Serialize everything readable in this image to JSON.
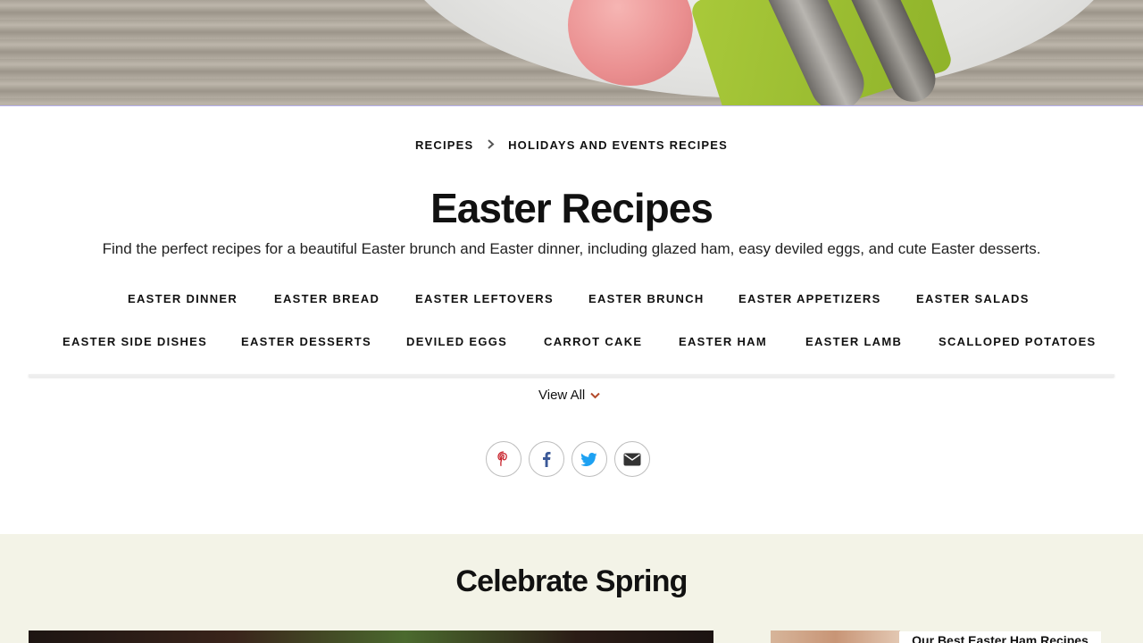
{
  "breadcrumb": [
    "RECIPES",
    "HOLIDAYS AND EVENTS RECIPES"
  ],
  "page_title": "Easter Recipes",
  "description": "Find the perfect recipes for a beautiful Easter brunch and Easter dinner, including glazed ham, easy deviled eggs, and cute Easter desserts.",
  "taxonomy_links": [
    "EASTER DINNER",
    "EASTER BREAD",
    "EASTER LEFTOVERS",
    "EASTER BRUNCH",
    "EASTER APPETIZERS",
    "EASTER SALADS",
    "EASTER SIDE DISHES",
    "EASTER DESSERTS",
    "DEVILED EGGS",
    "CARROT CAKE",
    "EASTER HAM",
    "EASTER LAMB",
    "SCALLOPED POTATOES"
  ],
  "view_all": "View All",
  "share_icons": [
    "pinterest-icon",
    "facebook-icon",
    "twitter-icon",
    "email-icon"
  ],
  "section": {
    "title": "Celebrate Spring",
    "card_label": "Our Best Easter Ham Recipes"
  },
  "colors": {
    "section_bg": "#f3f3e7",
    "pinterest": "#c8232c",
    "facebook": "#3b5998",
    "twitter": "#1da1f2"
  }
}
